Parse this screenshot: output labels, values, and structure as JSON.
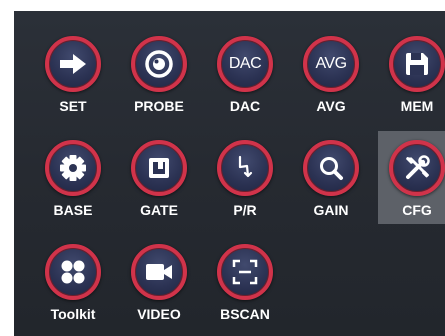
{
  "menu": {
    "items": [
      {
        "label": "SET",
        "icon": "arrow-right-icon"
      },
      {
        "label": "PROBE",
        "icon": "probe-icon"
      },
      {
        "label": "DAC",
        "icon": "dac-text-icon",
        "icon_text": "DAC"
      },
      {
        "label": "AVG",
        "icon": "avg-text-icon",
        "icon_text": "AVG"
      },
      {
        "label": "MEM",
        "icon": "save-disk-icon"
      },
      {
        "label": "BASE",
        "icon": "gear-icon"
      },
      {
        "label": "GATE",
        "icon": "gate-icon"
      },
      {
        "label": "P/R",
        "icon": "pulse-icon"
      },
      {
        "label": "GAIN",
        "icon": "magnifier-icon"
      },
      {
        "label": "CFG",
        "icon": "tools-icon",
        "selected": true
      },
      {
        "label": "Toolkit",
        "icon": "four-dots-icon"
      },
      {
        "label": "VIDEO",
        "icon": "video-camera-icon"
      },
      {
        "label": "BSCAN",
        "icon": "scan-frame-icon"
      }
    ]
  },
  "colors": {
    "panel_background": "#262a31",
    "button_ring": "#d1334a",
    "button_fill": "#2c3354",
    "selected_background": "#5d6168",
    "label_text": "#ffffff"
  }
}
